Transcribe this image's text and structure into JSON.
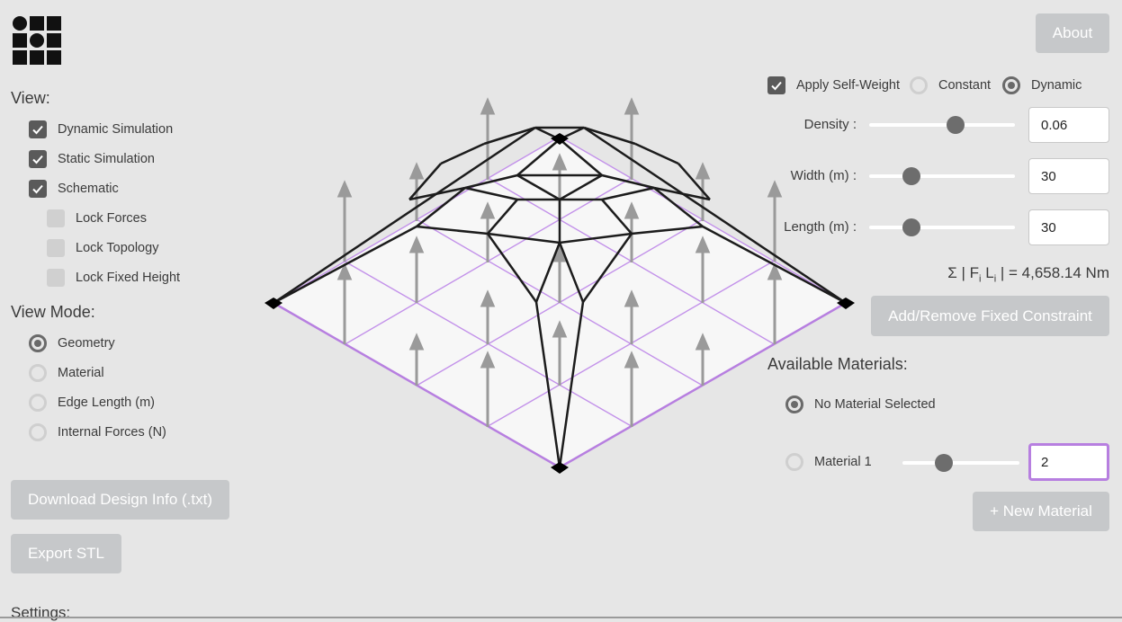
{
  "view": {
    "title": "View:",
    "options": [
      {
        "label": "Dynamic Simulation",
        "checked": true
      },
      {
        "label": "Static Simulation",
        "checked": true
      },
      {
        "label": "Schematic",
        "checked": true
      },
      {
        "label": "Lock Forces",
        "checked": false
      },
      {
        "label": "Lock Topology",
        "checked": false
      },
      {
        "label": "Lock Fixed Height",
        "checked": false
      }
    ]
  },
  "view_mode": {
    "title": "View Mode:",
    "options": [
      {
        "label": "Geometry",
        "selected": true
      },
      {
        "label": "Material",
        "selected": false
      },
      {
        "label": "Edge Length (m)",
        "selected": false
      },
      {
        "label": "Internal Forces (N)",
        "selected": false
      }
    ]
  },
  "buttons": {
    "download": "Download Design Info (.txt)",
    "export_stl": "Export STL",
    "about": "About",
    "fixed_constraint": "Add/Remove Fixed Constraint",
    "new_material": "+ New Material"
  },
  "settings_title": "Settings:",
  "self_weight": {
    "apply_label": "Apply Self-Weight",
    "apply_checked": true,
    "constant_label": "Constant",
    "constant_selected": false,
    "dynamic_label": "Dynamic",
    "dynamic_selected": true
  },
  "params": {
    "density": {
      "label": "Density :",
      "value": "0.06",
      "slider": 0.65
    },
    "width": {
      "label": "Width (m) :",
      "value": "30",
      "slider": 0.29
    },
    "length": {
      "label": "Length (m) :",
      "value": "30",
      "slider": 0.29
    }
  },
  "sum_label": "Σ | F",
  "sum_sub1": "i",
  "sum_mid": " L",
  "sum_sub2": "i",
  "sum_value": " | = 4,658.14 Nm",
  "materials": {
    "title": "Available Materials:",
    "none_label": "No Material Selected",
    "none_selected": true,
    "items": [
      {
        "label": "Material 1",
        "selected": false,
        "value": "2",
        "slider": 0.45
      }
    ]
  },
  "colors": {
    "background": "#e6e6e6",
    "button": "#c6c8ca",
    "grid": "#b77fe0",
    "structure": "#1c1c1c",
    "force_arrow": "#9a9a9a"
  }
}
